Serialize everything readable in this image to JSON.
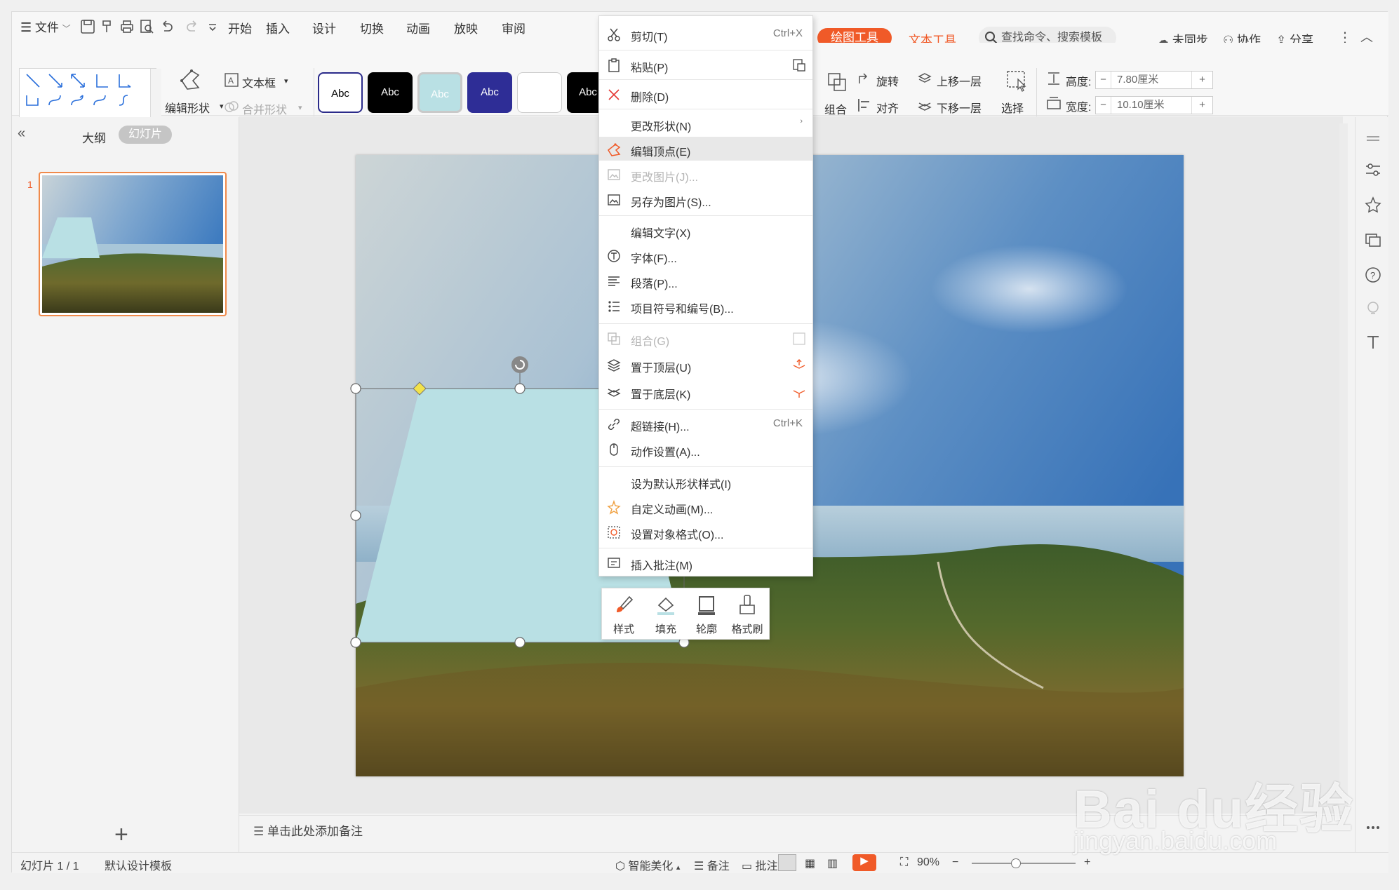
{
  "menubar": {
    "file": "文件",
    "tabs": [
      "开始",
      "插入",
      "设计",
      "切换",
      "动画",
      "放映",
      "审阅"
    ],
    "drawing_tools": "绘图工具",
    "text_tools": "文本工具",
    "search_placeholder": "查找命令、搜索模板",
    "sync": "未同步",
    "collab": "协作",
    "share": "分享"
  },
  "ribbon": {
    "edit_shape": "编辑形状",
    "text_box": "文本框",
    "merge_shape": "合并形状",
    "style_samples": [
      "Abc",
      "Abc",
      "Abc",
      "Abc",
      "",
      "Abc"
    ],
    "group": "组合",
    "rotate": "旋转",
    "align": "对齐",
    "bring_forward": "上移一层",
    "send_backward": "下移一层",
    "select": "选择",
    "height_label": "高度:",
    "height_value": "7.80厘米",
    "width_label": "宽度:",
    "width_value": "10.10厘米"
  },
  "leftpanel": {
    "outline_tab": "大纲",
    "slides_tab": "幻灯片",
    "slide_number": "1",
    "add": "+"
  },
  "notes": {
    "placeholder": "单击此处添加备注"
  },
  "context_menu": {
    "cut": "剪切(T)",
    "cut_shortcut": "Ctrl+X",
    "paste": "粘贴(P)",
    "delete": "删除(D)",
    "change_shape": "更改形状(N)",
    "edit_points": "编辑顶点(E)",
    "change_picture": "更改图片(J)...",
    "save_as_picture": "另存为图片(S)...",
    "edit_text": "编辑文字(X)",
    "font": "字体(F)...",
    "paragraph": "段落(P)...",
    "bullets": "项目符号和编号(B)...",
    "group": "组合(G)",
    "bring_to_front": "置于顶层(U)",
    "send_to_back": "置于底层(K)",
    "hyperlink": "超链接(H)...",
    "hyperlink_shortcut": "Ctrl+K",
    "action": "动作设置(A)...",
    "set_default": "设为默认形状样式(I)",
    "custom_animation": "自定义动画(M)...",
    "format_object": "设置对象格式(O)...",
    "insert_comment": "插入批注(M)"
  },
  "mini_toolbar": {
    "style": "样式",
    "fill": "填充",
    "outline": "轮廓",
    "format_painter": "格式刷"
  },
  "statusbar": {
    "slide_info": "幻灯片 1 / 1",
    "template": "默认设计模板",
    "beautify": "智能美化",
    "notes": "备注",
    "comments": "批注",
    "zoom": "90%"
  },
  "watermark": {
    "brand": "Bai du经验",
    "url": "jingyan.baidu.com"
  },
  "colors": {
    "accent": "#f05a28",
    "shape_fill": "#b9e0e4",
    "highlight": "#e8e8e8",
    "arrow": "#e53935"
  }
}
